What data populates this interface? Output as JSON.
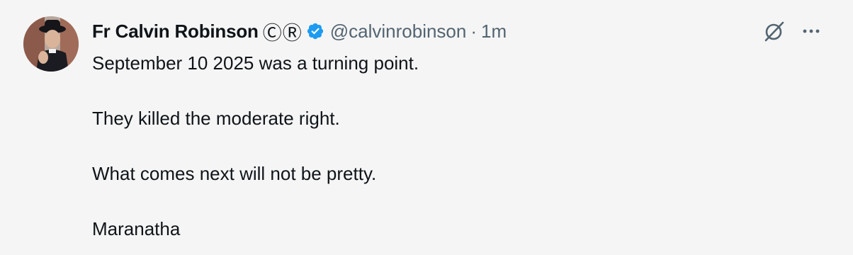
{
  "author": {
    "display_name": "Fr Calvin Robinson",
    "name_emoji": "ⒸⓇ",
    "handle": "@calvinrobinson",
    "separator": "·",
    "time": "1m",
    "verified": true,
    "verified_color": "#1d9bf0"
  },
  "tweet": {
    "paragraphs": [
      "September 10 2025 was a turning point.",
      "They killed the moderate right.",
      "What comes next will not be pretty.",
      "Maranatha"
    ]
  },
  "actions": {
    "grok_icon": "grok-icon",
    "more_icon": "more-icon"
  },
  "colors": {
    "background": "#f5f5f5",
    "text": "#0f1419",
    "secondary_text": "#536471"
  }
}
